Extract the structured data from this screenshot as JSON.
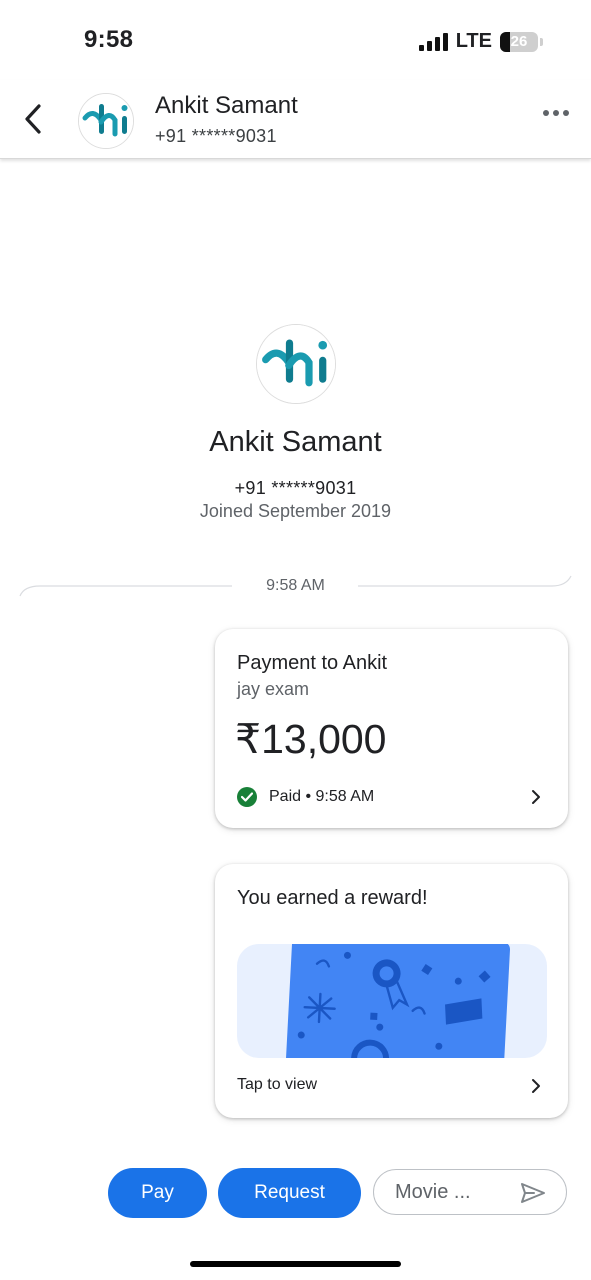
{
  "status_bar": {
    "time": "9:58",
    "network": "LTE",
    "battery": "26"
  },
  "header": {
    "name": "Ankit Samant",
    "phone": "+91 ******9031"
  },
  "profile": {
    "name": "Ankit Samant",
    "phone": "+91 ******9031",
    "joined": "Joined September 2019"
  },
  "divider_time": "9:58 AM",
  "payment_card": {
    "title": "Payment to Ankit",
    "note": "jay exam",
    "amount": "₹13,000",
    "status": "Paid • 9:58 AM"
  },
  "reward_card": {
    "title": "You earned a reward!",
    "action": "Tap to view"
  },
  "actions": {
    "pay": "Pay",
    "request": "Request",
    "message_value": "Movie ..."
  },
  "colors": {
    "primary": "#1a73e8",
    "success": "#188038",
    "reward_bg": "#e8f0fe",
    "reward_card": "#4285f4"
  }
}
